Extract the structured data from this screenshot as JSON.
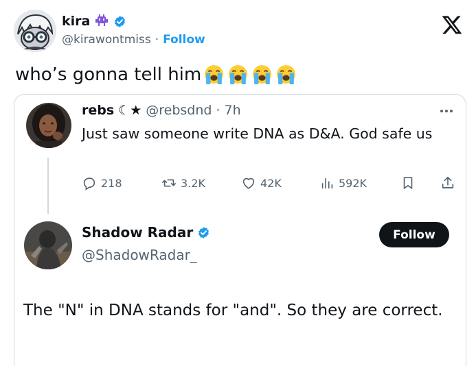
{
  "outer_tweet": {
    "author_name": "kira",
    "author_handle": "@kirawontmiss",
    "separator": "·",
    "follow_label": "Follow",
    "text": "who’s gonna tell him",
    "reaction_emoji": [
      "loudly-crying-face",
      "loudly-crying-face",
      "loudly-crying-face",
      "loudly-crying-face"
    ]
  },
  "quoted_tweet": {
    "author_name": "rebs",
    "name_decoration": "☾★",
    "author_handle": "@rebsdnd",
    "separator": "·",
    "time": "7h",
    "text": "Just saw someone write DNA as D&A. God safe us",
    "actions": {
      "replies": "218",
      "reposts": "3.2K",
      "likes": "42K",
      "views": "592K"
    }
  },
  "reply_tweet": {
    "author_name": "Shadow Radar",
    "author_handle": "@ShadowRadar_",
    "follow_button_label": "Follow",
    "text": "The \"N\" in DNA stands for \"and\". So they are correct."
  },
  "colors": {
    "text": "#0f1419",
    "secondary_text": "#536471",
    "link_blue": "#1d9bf0",
    "verified_blue": "#1d9bf0",
    "border": "#cfd9de",
    "button_dark": "#0f1419"
  }
}
